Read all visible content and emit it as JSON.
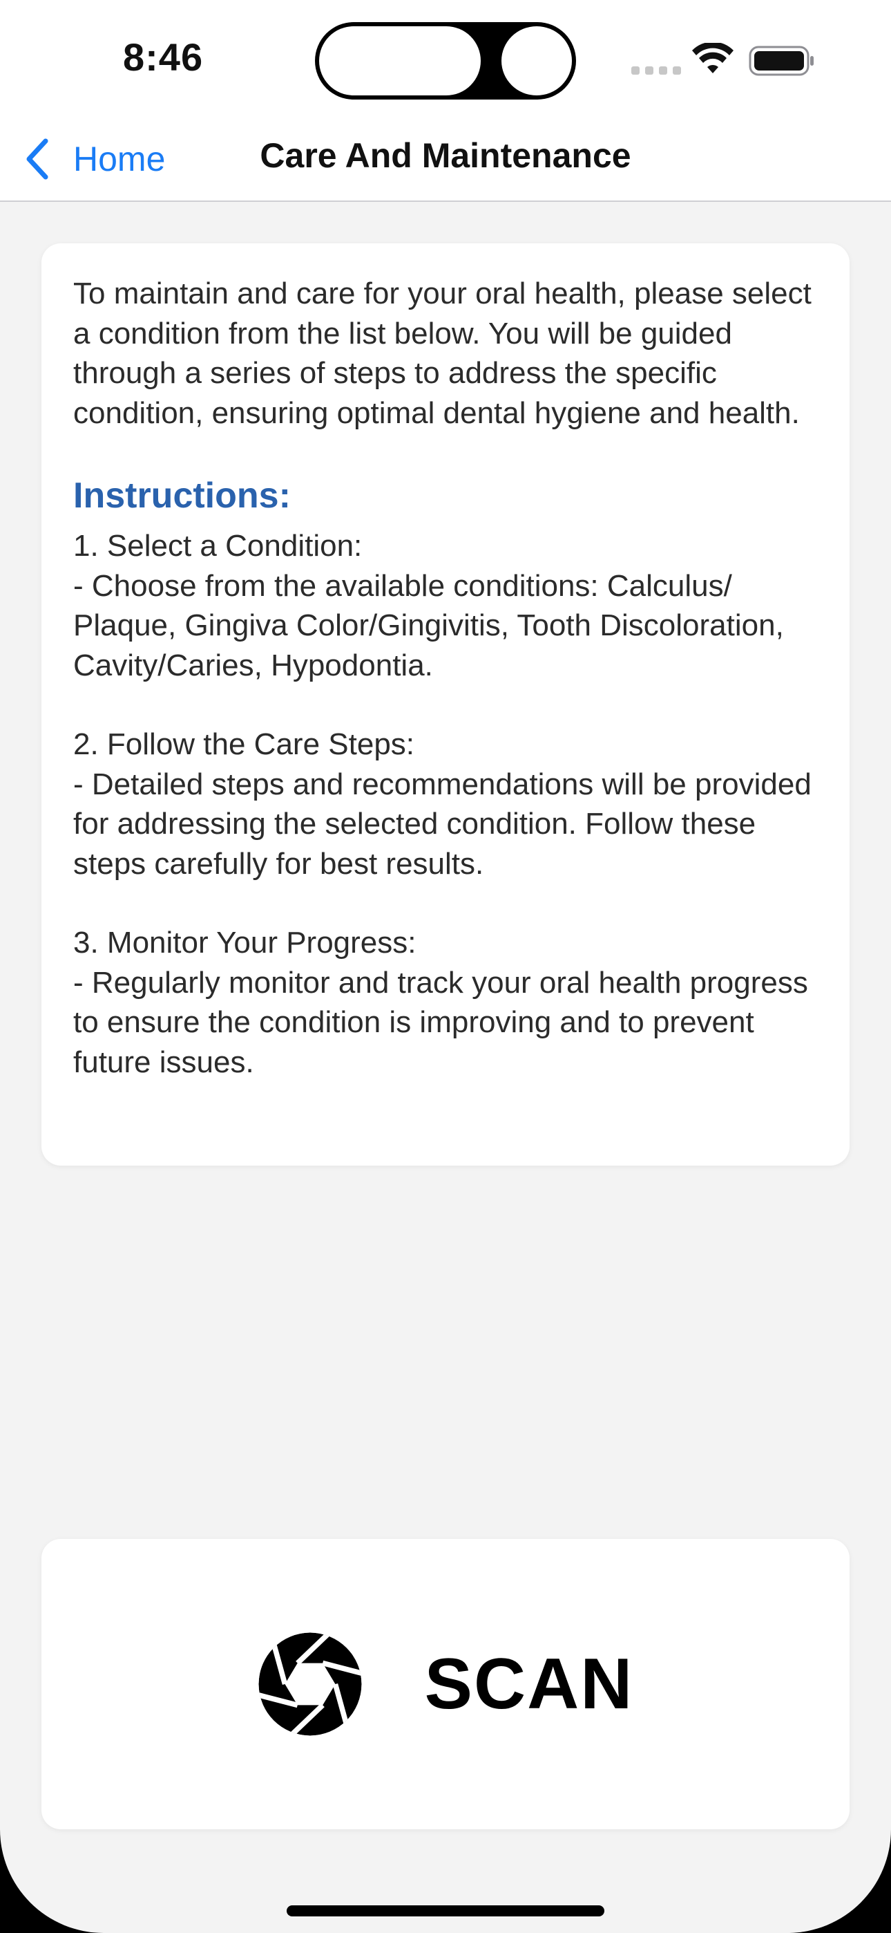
{
  "status_bar": {
    "time": "8:46",
    "wifi_icon": "wifi-icon",
    "battery_icon": "battery-icon"
  },
  "nav": {
    "back_label": "Home",
    "back_icon": "chevron-left-icon",
    "title": "Care And Maintenance",
    "accent_color": "#1a7cf5"
  },
  "info_card": {
    "intro": "To maintain and care for your oral health, please select a condition from the list below. You will be guided through a series of steps to address the specific condition, ensuring optimal dental hygiene and health.",
    "instructions_heading": "Instructions:",
    "heading_color": "#2a62ad",
    "steps": [
      {
        "title": "1. Select a Condition:",
        "detail": "- Choose from the available conditions: Calculus/ Plaque, Gingiva Color/Gingivitis, Tooth Discoloration, Cavity/Caries, Hypodontia."
      },
      {
        "title": "2. Follow the Care Steps:",
        "detail": "- Detailed steps and recommendations will be provided for addressing the selected condition. Follow these steps carefully for best results."
      },
      {
        "title": "3. Monitor Your Progress:",
        "detail": "- Regularly monitor and track your oral health progress to ensure the condition is improving and to prevent future issues."
      }
    ]
  },
  "scan_button": {
    "label": "SCAN",
    "icon": "camera-aperture-icon"
  }
}
